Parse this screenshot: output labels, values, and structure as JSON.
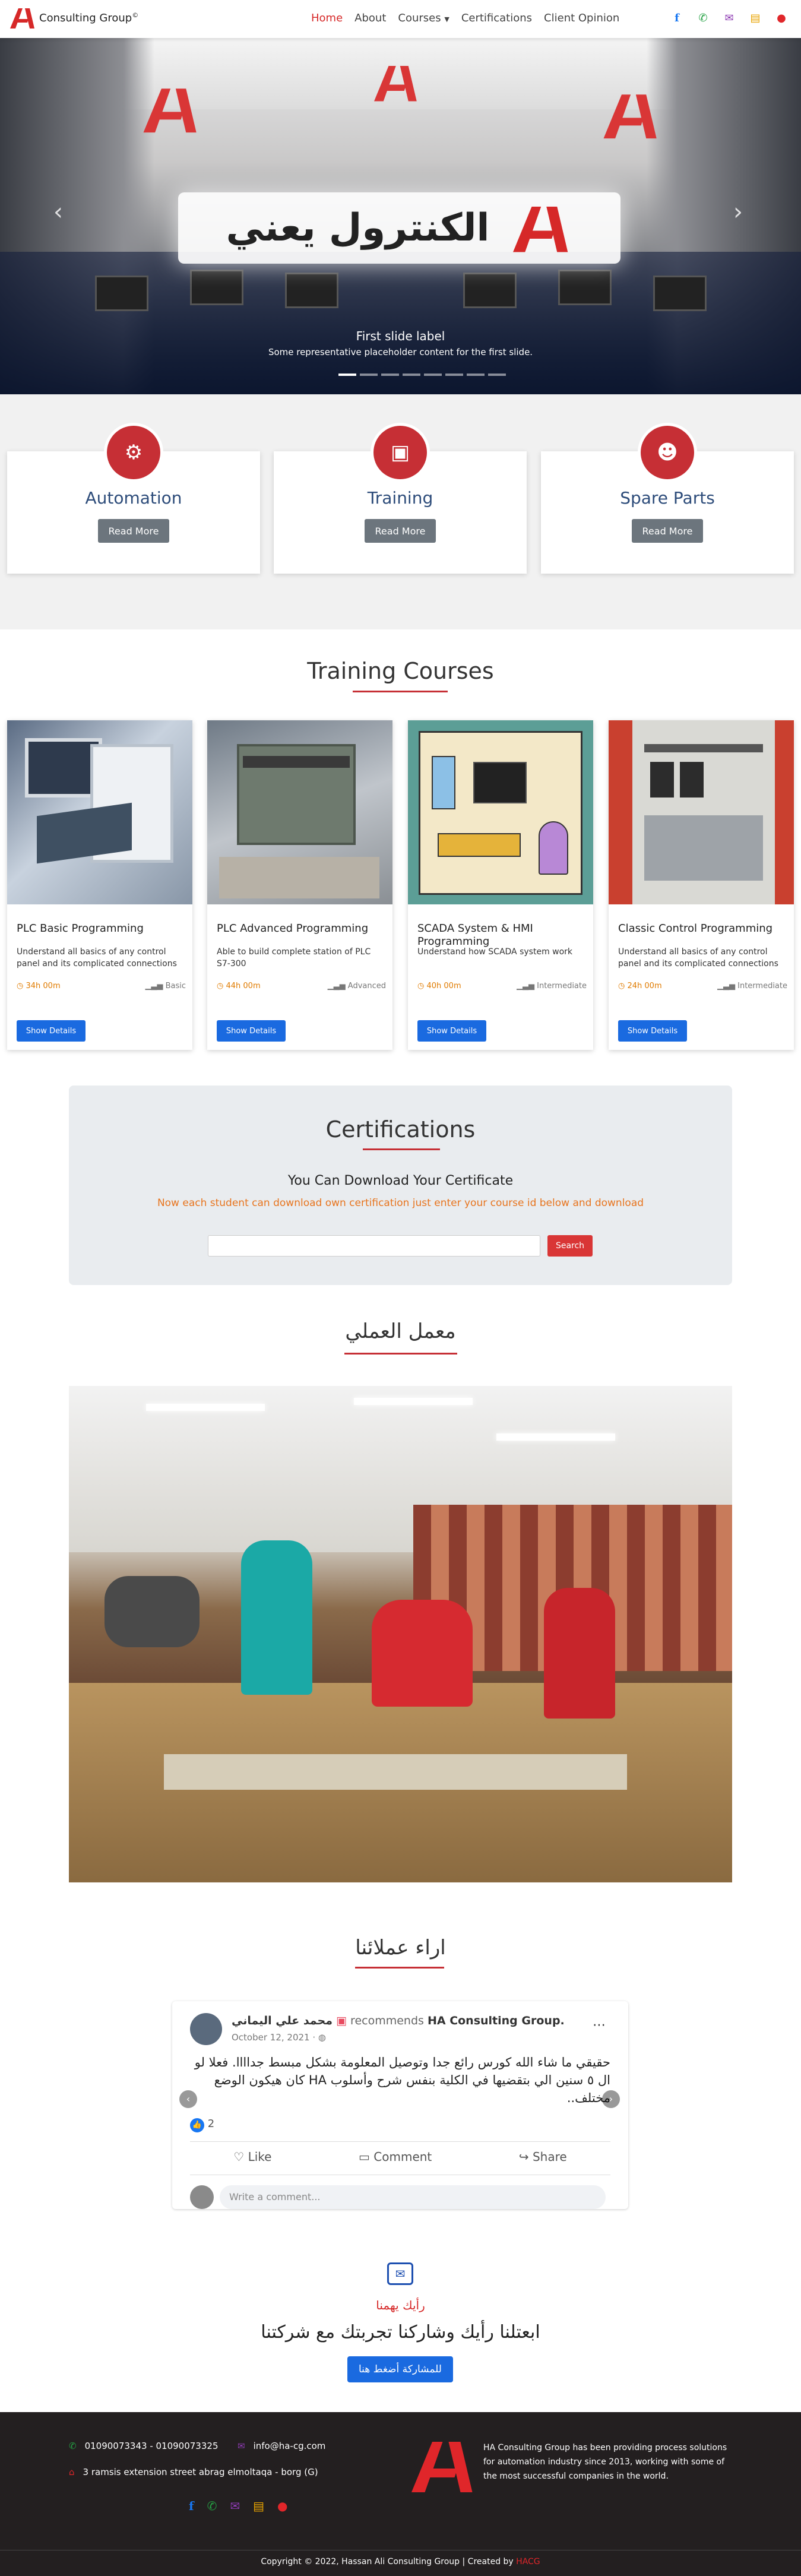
{
  "nav": {
    "brand": "Consulting Group",
    "brand_mark": "©",
    "links": [
      "Home",
      "About",
      "Courses",
      "Certifications",
      "Client Opinion"
    ],
    "active": "Home",
    "icons": [
      "facebook-icon",
      "phone-icon",
      "email-icon",
      "shop-icon",
      "location-icon"
    ],
    "icon_colors": [
      "#1877f2",
      "#25a244",
      "#8e3bb3",
      "#e8a300",
      "#e0262a"
    ]
  },
  "hero": {
    "sign_text": "الكنترول يعني",
    "caption_title": "First slide label",
    "caption_text": "Some representative placeholder content for the first slide.",
    "slide_count": 8,
    "active_slide": 1
  },
  "services": [
    {
      "title": "Automation",
      "button": "Read More",
      "icon": "gear-icon"
    },
    {
      "title": "Training",
      "button": "Read More",
      "icon": "presentation-icon"
    },
    {
      "title": "Spare Parts",
      "button": "Read More",
      "icon": "users-icon"
    }
  ],
  "courses_title": "Training Courses",
  "courses": [
    {
      "title": "PLC Basic Programming",
      "desc": "Understand all basics of any control panel and its complicated connections",
      "hours": "34h 00m",
      "level": "Basic",
      "button": "Show Details"
    },
    {
      "title": "PLC Advanced Programming",
      "desc": "Able to build complete station of PLC S7-300",
      "hours": "44h 00m",
      "level": "Advanced",
      "button": "Show Details"
    },
    {
      "title": "SCADA System & HMI Programming",
      "desc": "Understand how SCADA system work",
      "hours": "40h 00m",
      "level": "Intermediate",
      "button": "Show Details"
    },
    {
      "title": "Classic Control Programming",
      "desc": "Understand all basics of any control panel and its complicated connections",
      "hours": "24h 00m",
      "level": "Intermediate",
      "button": "Show Details"
    }
  ],
  "certifications": {
    "title": "Certifications",
    "subtitle": "You Can Download Your Certificate",
    "note": "Now each student can download own certification just enter your course id below and download",
    "input_placeholder": "",
    "button": "Search"
  },
  "lab_title": "معمل العملي",
  "opinions_title": "اراء عملائنا",
  "testimonial": {
    "name": "محمد علي اليماني",
    "recommends": "recommends",
    "page": "HA Consulting Group.",
    "date": "October 12, 2021 · ",
    "text": "حقيقي ما شاء الله كورس رائع جدا وتوصيل المعلومة بشكل مبسط جداااا. فعلا لو ال ٥ سنين الي بتقضيها في الكلية بنفس شرح وأسلوب HA كان هيكون الوضع مختلف..",
    "reactions": "2",
    "like": "Like",
    "comment": "Comment",
    "share": "Share",
    "write_comment": "Write a comment..."
  },
  "feedback": {
    "small_title": "رأيك يهمنا",
    "heading": "ابعتلنا رأيك وشاركنا تجربتك مع شركتنا",
    "button": "للمشاركة أضغط هنا"
  },
  "footer": {
    "phones": "01090073343 - 01090073325",
    "email": "info@ha-cg.com",
    "address": "3 ramsis extension street abrag elmoltaqa - borg (G)",
    "about": "HA Consulting Group has been providing process solutions for automation industry since 2013, working with some of the most successful companies in the world.",
    "copyright": "Copyright © 2022, Hassan Ali Consulting Group | Created by ",
    "creator": "HACG"
  }
}
